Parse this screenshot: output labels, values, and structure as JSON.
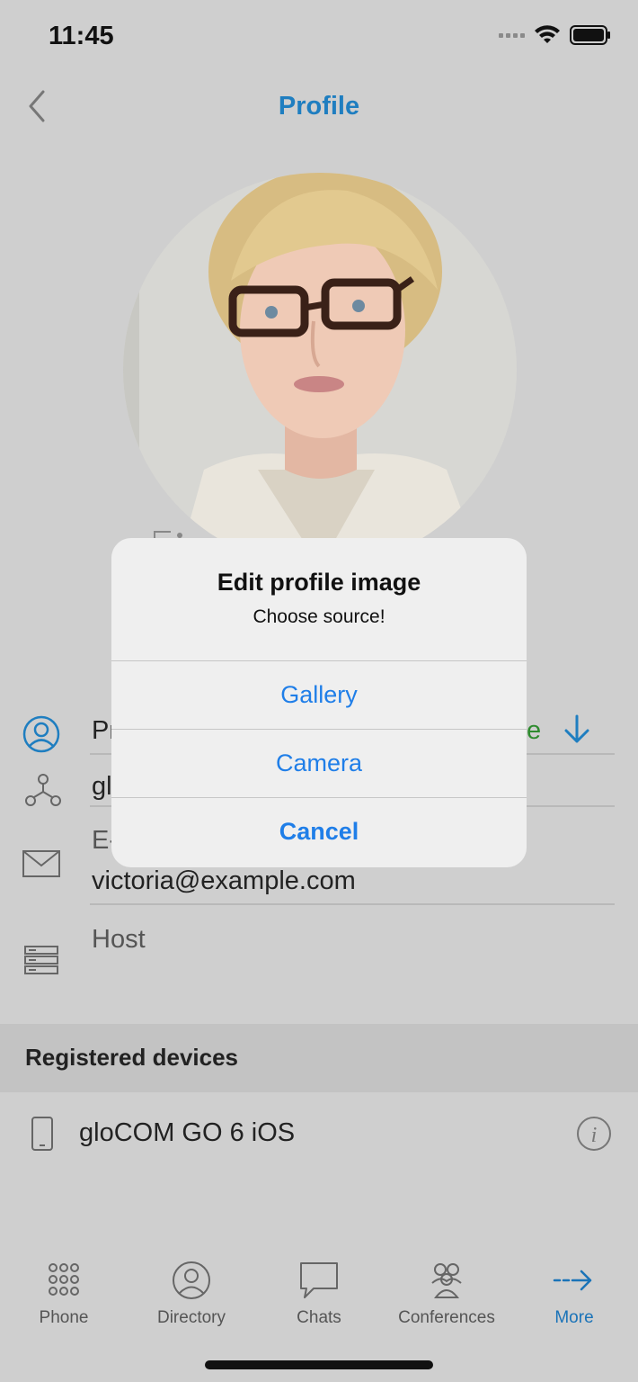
{
  "status_bar": {
    "time": "11:45"
  },
  "header": {
    "title": "Profile",
    "back_icon": "chevron-left-icon"
  },
  "profile": {
    "fields": [
      {
        "icon": "user-icon",
        "text": "Pr",
        "trailing_text": "e"
      },
      {
        "icon": "network-icon",
        "text": "gl"
      },
      {
        "icon": "mail-icon",
        "label": "E-",
        "value": "victoria@example.com"
      },
      {
        "icon": "server-icon",
        "text": "Host"
      }
    ]
  },
  "registered_devices": {
    "title": "Registered devices",
    "devices": [
      {
        "name": "gloCOM GO 6 iOS",
        "icon": "phone-device-icon",
        "info_icon": "info-icon"
      }
    ]
  },
  "dialog": {
    "title": "Edit profile image",
    "message": "Choose source!",
    "buttons": [
      "Gallery",
      "Camera",
      "Cancel"
    ]
  },
  "tab_bar": {
    "tabs": [
      {
        "label": "Phone",
        "icon": "dialpad-icon",
        "active": false
      },
      {
        "label": "Directory",
        "icon": "user-circle-icon",
        "active": false
      },
      {
        "label": "Chats",
        "icon": "chat-bubble-icon",
        "active": false
      },
      {
        "label": "Conferences",
        "icon": "group-icon",
        "active": false
      },
      {
        "label": "More",
        "icon": "arrow-right-icon",
        "active": true
      }
    ]
  },
  "colors": {
    "accent": "#1f7ec0",
    "dialog_button": "#1f7ee8",
    "trailing_text": "#2e8b2e",
    "background": "#cfcfcf"
  }
}
